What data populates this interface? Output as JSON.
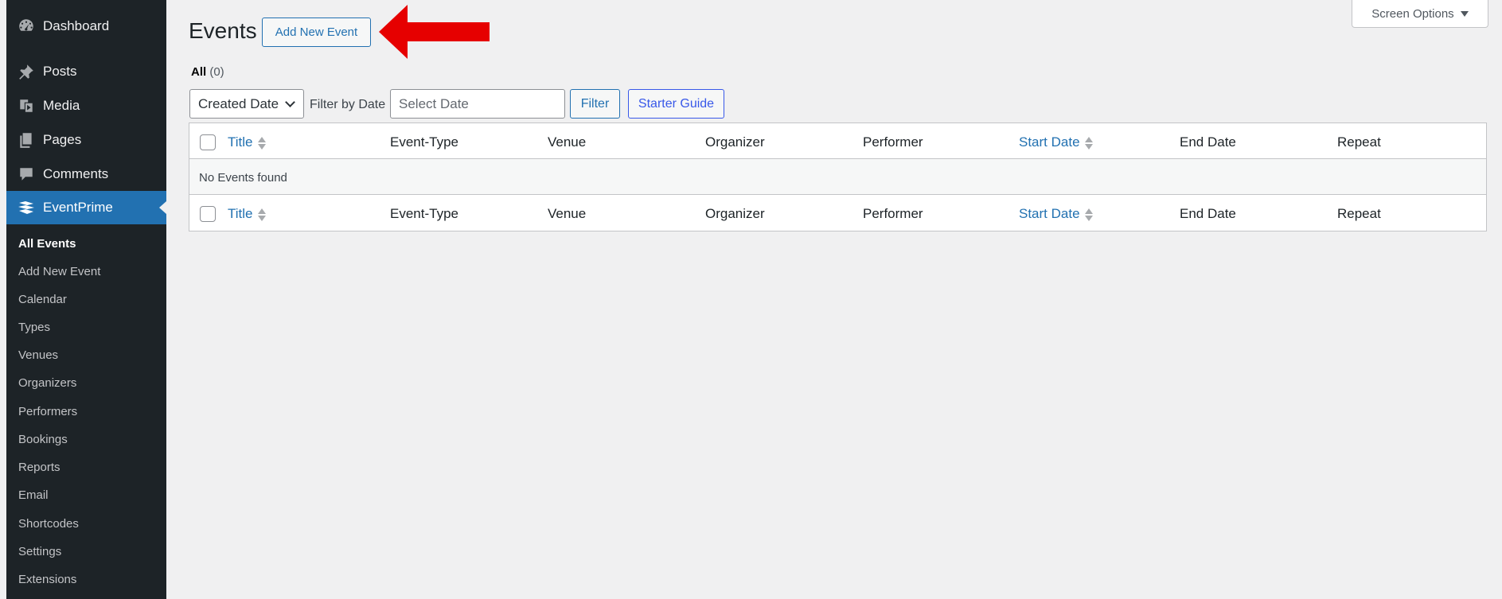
{
  "sidebar": {
    "items": [
      {
        "label": "Dashboard",
        "icon": "dashboard-icon"
      },
      {
        "label": "Posts",
        "icon": "pin-icon"
      },
      {
        "label": "Media",
        "icon": "media-icon"
      },
      {
        "label": "Pages",
        "icon": "pages-icon"
      },
      {
        "label": "Comments",
        "icon": "comment-icon"
      },
      {
        "label": "EventPrime",
        "icon": "eventprime-icon",
        "active": true
      }
    ],
    "submenu": [
      {
        "label": "All Events",
        "current": true
      },
      {
        "label": "Add New Event"
      },
      {
        "label": "Calendar"
      },
      {
        "label": "Types"
      },
      {
        "label": "Venues"
      },
      {
        "label": "Organizers"
      },
      {
        "label": "Performers"
      },
      {
        "label": "Bookings"
      },
      {
        "label": "Reports"
      },
      {
        "label": "Email"
      },
      {
        "label": "Shortcodes"
      },
      {
        "label": "Settings"
      },
      {
        "label": "Extensions"
      }
    ]
  },
  "header": {
    "title": "Events",
    "add_new_label": "Add New Event",
    "screen_options_label": "Screen Options"
  },
  "views": {
    "all_label": "All",
    "all_count": "(0)"
  },
  "filters": {
    "date_select_value": "Created Date",
    "filter_by_label": "Filter by Date",
    "date_placeholder": "Select Date",
    "filter_button": "Filter",
    "starter_guide_button": "Starter Guide"
  },
  "table": {
    "columns": {
      "title": "Title",
      "event_type": "Event-Type",
      "venue": "Venue",
      "organizer": "Organizer",
      "performer": "Performer",
      "start_date": "Start Date",
      "end_date": "End Date",
      "repeat": "Repeat"
    },
    "empty_message": "No Events found"
  },
  "colors": {
    "sidebar_bg": "#1d2327",
    "accent": "#2271b1",
    "annotation_arrow": "#e60000"
  }
}
